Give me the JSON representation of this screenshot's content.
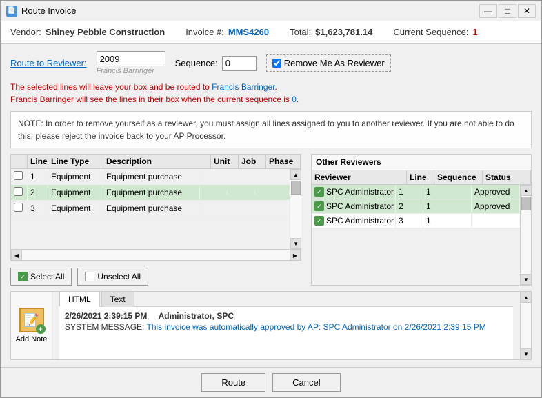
{
  "window": {
    "title": "Route Invoice",
    "icon": "📄"
  },
  "header": {
    "vendor_label": "Vendor:",
    "vendor_value": "Shiney Pebble Construction",
    "invoice_label": "Invoice #:",
    "invoice_value": "MMS4260",
    "total_label": "Total:",
    "total_value": "$1,623,781.14",
    "sequence_label": "Current Sequence:",
    "sequence_value": "1"
  },
  "route_section": {
    "route_link": "Route to Reviewer:",
    "reviewer_id": "2009",
    "reviewer_name": "Francis Barringer",
    "sequence_label": "Sequence:",
    "sequence_value": "0",
    "checkbox_label": "Remove Me As Reviewer",
    "checkbox_checked": true
  },
  "info_messages": {
    "line1": "The selected lines will leave your box and be routed to Francis Barringer.",
    "line2": "Francis Barringer will see the lines in their box when the current sequence is 0."
  },
  "note_box": {
    "text": "NOTE: In order to remove yourself as a reviewer, you must assign all lines assigned to you to another reviewer. If you are not able to do this, please reject the invoice back to your AP Processor."
  },
  "lines_table": {
    "columns": [
      "",
      "Line",
      "Line Type",
      "Description",
      "Unit",
      "Job",
      "Phase"
    ],
    "rows": [
      {
        "checked": false,
        "line": "1",
        "line_type": "Equipment",
        "description": "Equipment purchase",
        "unit": "",
        "job": "",
        "phase": "",
        "highlighted": false
      },
      {
        "checked": false,
        "line": "2",
        "line_type": "Equipment",
        "description": "Equipment purchase",
        "unit": "",
        "job": "",
        "phase": "",
        "highlighted": true
      },
      {
        "checked": false,
        "line": "3",
        "line_type": "Equipment",
        "description": "Equipment purchase",
        "unit": "",
        "job": "",
        "phase": "",
        "highlighted": false
      }
    ],
    "select_all": "Select All",
    "unselect_all": "Unselect All"
  },
  "other_reviewers": {
    "title": "Other Reviewers",
    "columns": [
      "Reviewer",
      "Line",
      "Sequence",
      "Status"
    ],
    "rows": [
      {
        "reviewer": "SPC Administrator",
        "line": "1",
        "sequence": "1",
        "status": "Approved",
        "highlight": true
      },
      {
        "reviewer": "SPC Administrator",
        "line": "2",
        "sequence": "1",
        "status": "Approved",
        "highlight": true
      },
      {
        "reviewer": "SPC Administrator",
        "line": "3",
        "sequence": "1",
        "status": "",
        "highlight": false
      }
    ]
  },
  "notes": {
    "tabs": [
      "HTML",
      "Text"
    ],
    "active_tab": "HTML",
    "add_note_label": "Add Note",
    "entries": [
      {
        "date": "2/26/2021 2:39:15 PM",
        "author": "Administrator, SPC",
        "message": "SYSTEM MESSAGE: This invoice was automatically approved by AP: SPC Administrator on 2/26/2021 2:39:15 PM"
      }
    ]
  },
  "footer": {
    "route_btn": "Route",
    "cancel_btn": "Cancel"
  }
}
